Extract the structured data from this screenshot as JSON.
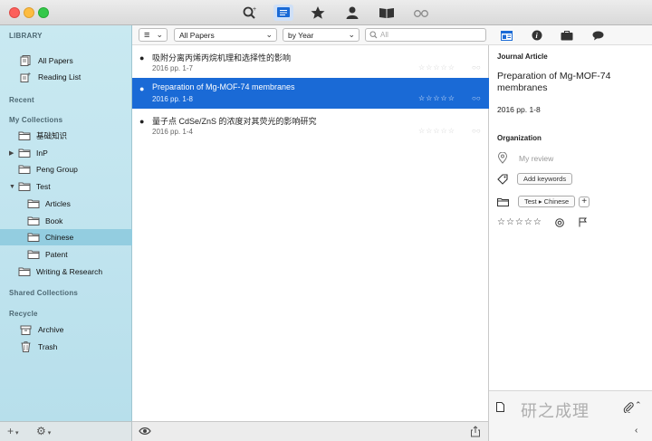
{
  "toolbar": {
    "icons": [
      "search-plus-icon",
      "list-view-icon",
      "star-icon",
      "person-icon",
      "book-icon",
      "glasses-icon"
    ],
    "active": "list-view-icon"
  },
  "sidebar": {
    "library_header": "LIBRARY",
    "library_items": [
      {
        "label": "All Papers",
        "icon": "papers-icon"
      },
      {
        "label": "Reading List",
        "icon": "reading-list-icon"
      }
    ],
    "recent_header": "Recent",
    "collections_header": "My Collections",
    "collections": [
      {
        "label": "基础知识",
        "indent": 0,
        "disclosure": ""
      },
      {
        "label": "InP",
        "indent": 0,
        "disclosure": "▶"
      },
      {
        "label": "Peng Group",
        "indent": 0,
        "disclosure": ""
      },
      {
        "label": "Test",
        "indent": 0,
        "disclosure": "▼"
      },
      {
        "label": "Articles",
        "indent": 1,
        "disclosure": ""
      },
      {
        "label": "Book",
        "indent": 1,
        "disclosure": ""
      },
      {
        "label": "Chinese",
        "indent": 1,
        "disclosure": "",
        "selected": true
      },
      {
        "label": "Patent",
        "indent": 1,
        "disclosure": ""
      },
      {
        "label": "Writing & Research",
        "indent": 0,
        "disclosure": ""
      }
    ],
    "shared_header": "Shared Collections",
    "recycle_header": "Recycle",
    "recycle_items": [
      {
        "label": "Archive",
        "icon": "archive-icon"
      },
      {
        "label": "Trash",
        "icon": "trash-icon"
      }
    ],
    "bottom": {
      "add": "+",
      "gear": "⚙"
    }
  },
  "filters": {
    "list_menu": "≡",
    "type_select": "All Papers",
    "sort_select": "by Year",
    "search_placeholder": "All"
  },
  "papers": [
    {
      "title": "吸附分离丙烯丙烷机理和选择性的影响",
      "meta": "2016 pp. 1-7",
      "selected": false
    },
    {
      "title": "Preparation of Mg-MOF-74 membranes",
      "meta": "2016 pp. 1-8",
      "selected": true
    },
    {
      "title": "量子点 CdSe/ZnS 的浓度对其荧光的影响研究",
      "meta": "2016 pp. 1-4",
      "selected": false
    }
  ],
  "stars": "☆☆☆☆☆",
  "inspector": {
    "tabs": [
      "info-icon-tab",
      "details-icon-tab",
      "files-icon-tab",
      "notes-icon-tab"
    ],
    "type": "Journal Article",
    "title": "Preparation of Mg-MOF-74 membranes",
    "meta": "2016 pp. 1-8",
    "organization_header": "Organization",
    "review_placeholder": "My review",
    "add_keywords": "Add keywords",
    "collection_path": "Test ▸ Chinese",
    "add_collection": "+",
    "rating": "☆☆☆☆☆"
  },
  "watermark": "研之成理"
}
